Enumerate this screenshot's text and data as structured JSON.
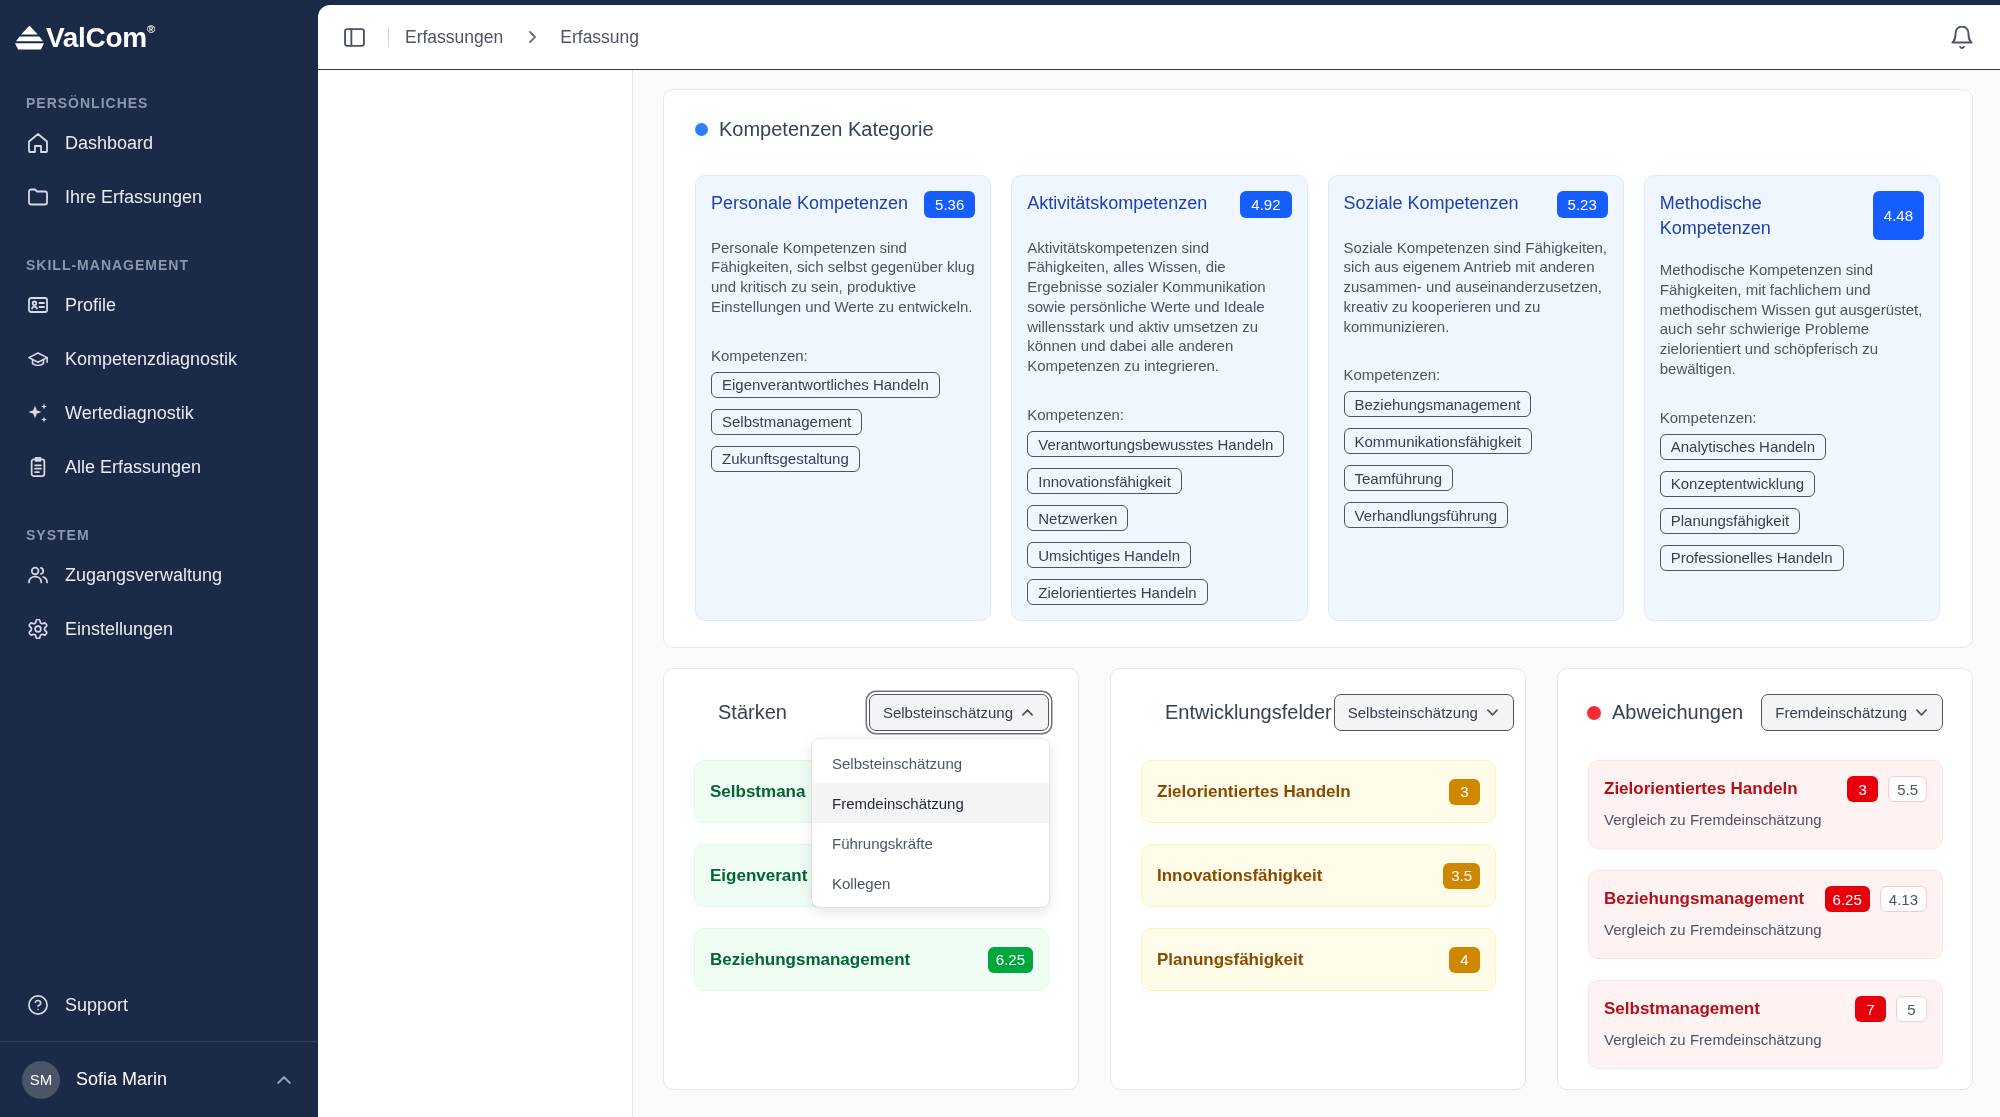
{
  "sidebar": {
    "logo": "ValCom$^{®}$",
    "sections": [
      {
        "heading": "PERSÖNLICHES",
        "items": [
          "Dashboard",
          "Ihre Erfassungen"
        ]
      },
      {
        "heading": "SKILL-MANAGEMENT",
        "items": [
          "Profile",
          "Kompetenzdiagnostik",
          "Wertediagnostik",
          "Alle Erfassungen"
        ]
      },
      {
        "heading": "SYSTEM",
        "items": [
          "Zugangsverwaltung",
          "Einstellungen"
        ]
      }
    ],
    "support": "Support",
    "user": {
      "initials": "SM",
      "name": "Sofia Marin"
    }
  },
  "header": {
    "breadcrumb": [
      "Erfassungen",
      "Erfassung"
    ]
  },
  "categories": {
    "title": "Kompetenzen Kategorie",
    "dot": true,
    "cards": [
      {
        "title": "Personale Kompetenzen",
        "score": "5.36",
        "description": "Personale Kompetenzen sind Fähigkeiten, sich selbst gegenüber klug und kritisch zu sein, produktive Einstellungen und Werte zu entwickeln.",
        "list_label": "Kompetenzen:",
        "tags": [
          "Eigenverantwortliches Handeln",
          "Selbstmanagement",
          "Zukunftsgestaltung"
        ]
      },
      {
        "title": "Aktivitätskompetenzen",
        "score": "4.92",
        "description": "Aktivitätskompetenzen sind Fähigkeiten, alles Wissen, die Ergebnisse sozialer Kommunikation sowie persönliche Werte und Ideale willensstark und aktiv umsetzen zu können und dabei alle anderen Kompetenzen zu integrieren.",
        "list_label": "Kompetenzen:",
        "tags": [
          "Verantwortungsbewusstes Handeln",
          "Innovationsfähigkeit",
          "Netzwerken",
          "Umsichtiges Handeln",
          "Zielorientiertes Handeln"
        ]
      },
      {
        "title": "Soziale Kompetenzen",
        "score": "5.23",
        "description": "Soziale Kompetenzen sind Fähigkeiten, sich aus eigenem Antrieb mit anderen zusammen- und auseinanderzusetzen, kreativ zu kooperieren und zu kommunizieren.",
        "list_label": "Kompetenzen:",
        "tags": [
          "Beziehungsmanagement",
          "Kommunikationsfähigkeit",
          "Teamführung",
          "Verhandlungsführung"
        ]
      },
      {
        "title": "Methodische Kompetenzen",
        "score": "4.48",
        "description": "Methodische Kompetenzen sind Fähigkeiten, mit fachlichem und methodischem Wissen gut ausgerüstet, auch sehr schwierige Probleme zielorientiert und schöpferisch zu bewältigen.",
        "list_label": "Kompetenzen:",
        "tags": [
          "Analytisches Handeln",
          "Konzeptentwicklung",
          "Planungsfähigkeit",
          "Professionelles Handeln"
        ]
      }
    ]
  },
  "panels": [
    {
      "kind": "strengths",
      "title": "Stärken",
      "dot": false,
      "select": {
        "value": "Selbsteinschätzung",
        "open": true,
        "options": [
          {
            "label": "Selbsteinschätzung",
            "highlighted": false
          },
          {
            "label": "Fremdeinschätzung",
            "highlighted": true
          },
          {
            "label": "Führungskräfte",
            "highlighted": false
          },
          {
            "label": "Kollegen",
            "highlighted": false
          }
        ]
      },
      "items": [
        {
          "name": "Selbstmana"
        },
        {
          "name": "Eigenverant"
        },
        {
          "name": "Beziehungsmanagement",
          "score": "6.25"
        }
      ]
    },
    {
      "kind": "development",
      "title": "Entwicklungsfelder",
      "dot": false,
      "select": {
        "value": "Selbsteinschätzung",
        "open": false
      },
      "items": [
        {
          "name": "Zielorientiertes Handeln",
          "score": "3"
        },
        {
          "name": "Innovationsfähigkeit",
          "score": "3.5"
        },
        {
          "name": "Planungsfähigkeit",
          "score": "4"
        }
      ]
    },
    {
      "kind": "deviations",
      "title": "Abweichungen",
      "dot": true,
      "select": {
        "value": "Fremdeinschätzung",
        "open": false
      },
      "items": [
        {
          "name": "Zielorientiertes Handeln",
          "score": "3",
          "comparison": "5.5",
          "note": "Vergleich zu Fremdeinschätzung"
        },
        {
          "name": "Beziehungsmanagement",
          "score": "6.25",
          "comparison": "4.13",
          "note": "Vergleich zu Fremdeinschätzung"
        },
        {
          "name": "Selbstmanagement",
          "score": "7",
          "comparison": "5",
          "note": "Vergleich zu Fremdeinschätzung"
        }
      ]
    }
  ]
}
